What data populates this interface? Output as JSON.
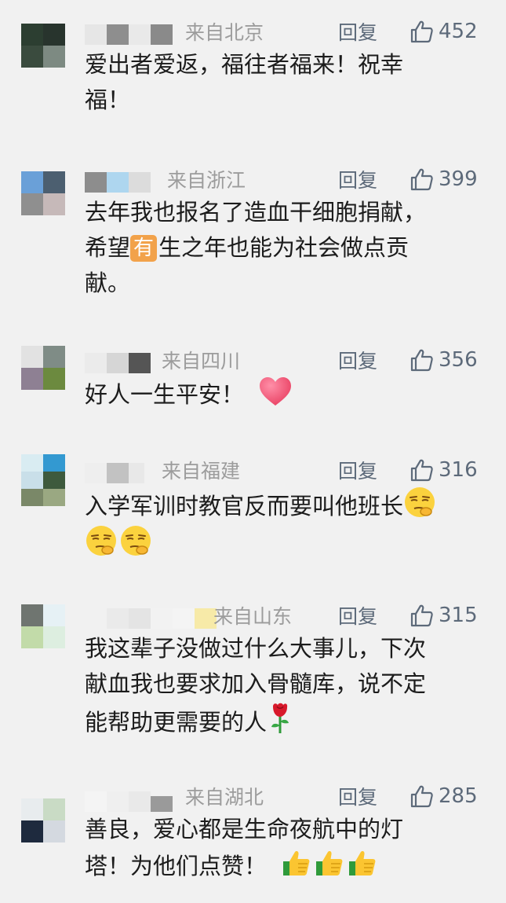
{
  "reply_label": "回复",
  "comments": [
    {
      "location": "来自北京",
      "likes": "452",
      "line1": "爱出者爱返，福往者福来！祝幸",
      "line2": "福！",
      "avatar_colors": [
        "#2c3e31",
        "#28342d",
        "#3a4b3e",
        "#7d8a82"
      ]
    },
    {
      "location": "来自浙江",
      "likes": "399",
      "line1": "去年我也报名了造血干细胞捐献，",
      "line2_before": "希望",
      "badge": "有",
      "line2_after": "生之年也能为社会做点贡",
      "line3": "献。",
      "avatar_colors": [
        "#6aa0d8",
        "#4c5f70",
        "#8f8f8f",
        "#c6b9b9"
      ]
    },
    {
      "location": "来自四川",
      "likes": "356",
      "line1": "好人一生平安！",
      "emoji": "heart",
      "avatar_colors": [
        "#e2e2e2",
        "#7f8c86",
        "#8e8093",
        "#6c8a3f"
      ]
    },
    {
      "location": "来自福建",
      "likes": "316",
      "line1": "入学军训时教官反而要叫他班长",
      "emoji": "smirk",
      "avatar_colors": [
        "#d9ecf2",
        "#3399d1",
        "#6e9cc1",
        "#3e5a3d",
        "#7a8868",
        "#9aa882"
      ]
    },
    {
      "location": "来自山东",
      "likes": "315",
      "line1": "我这辈子没做过什么大事儿，下次",
      "line2": "献血我也要求加入骨髓库，说不定",
      "line3": "能帮助更需要的人",
      "emoji": "rose",
      "avatar_colors": [
        "#6f7570",
        "#e6f1f5",
        "#c2dba9",
        "#ddeee0"
      ]
    },
    {
      "location": "来自湖北",
      "likes": "285",
      "line1": "善良，爱心都是生命夜航中的灯",
      "line2": "塔！为他们点赞！",
      "emoji": "thumbs",
      "avatar_colors": [
        "#e8ecee",
        "#c9dbc5",
        "#1e2a3e",
        "#d4d9e0"
      ]
    }
  ]
}
